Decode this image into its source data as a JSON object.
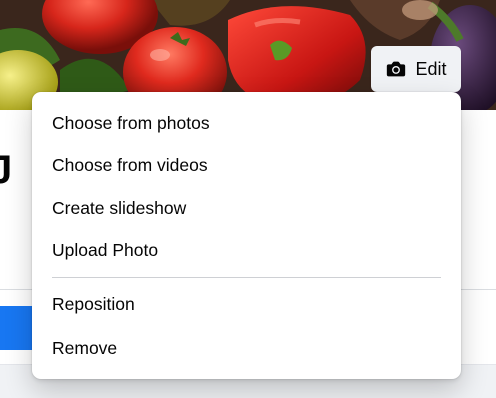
{
  "cover": {
    "edit_label": "Edit",
    "edit_icon": "camera-icon"
  },
  "menu": {
    "items": [
      {
        "label": "Choose from photos"
      },
      {
        "label": "Choose from videos"
      },
      {
        "label": "Create slideshow"
      },
      {
        "label": "Upload Photo"
      },
      {
        "label": "Reposition"
      },
      {
        "label": "Remove"
      }
    ]
  },
  "colors": {
    "accent": "#1877f2",
    "menu_bg": "#ffffff",
    "text": "#050505",
    "button_bg": "#f0f2f5"
  }
}
